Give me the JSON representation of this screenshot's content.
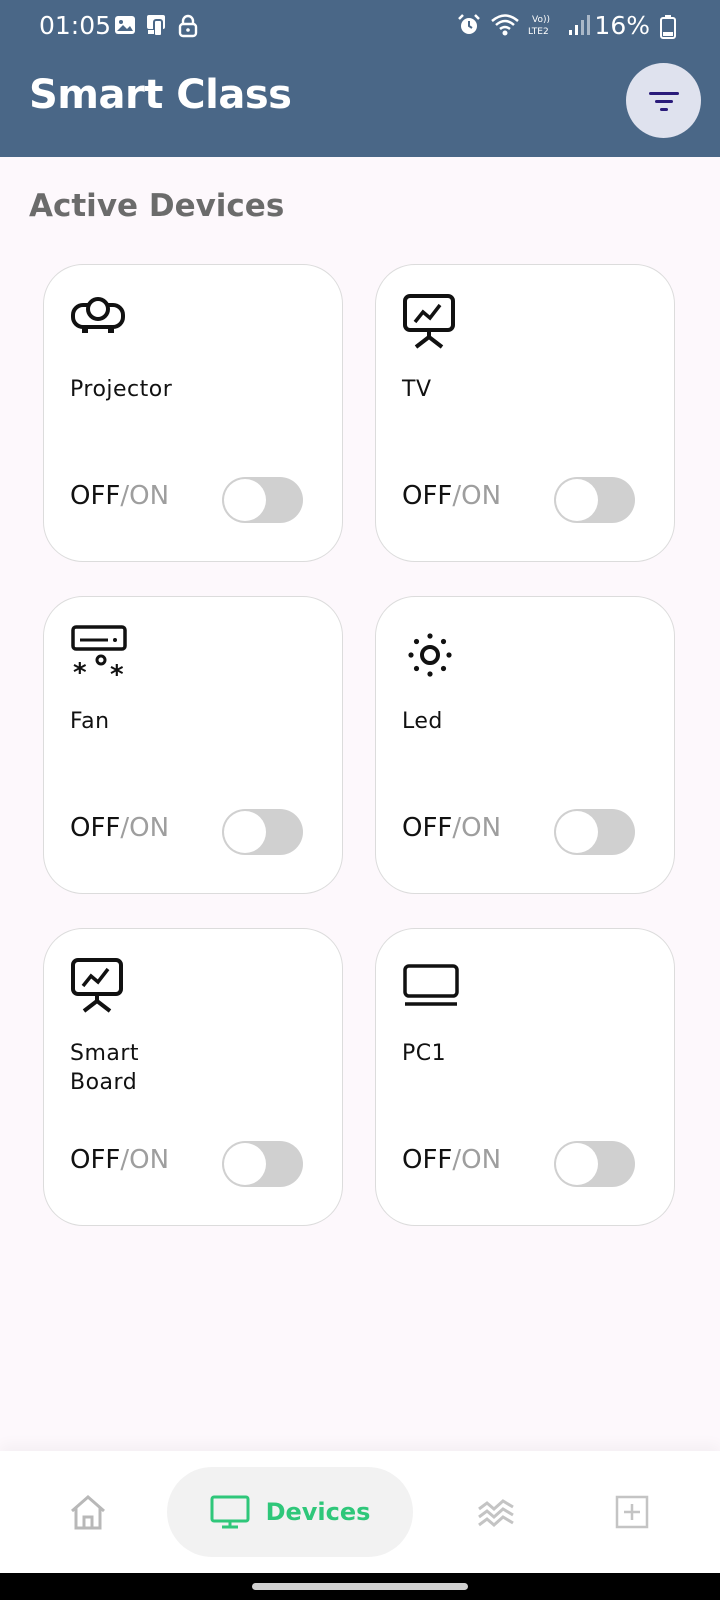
{
  "status_bar": {
    "time": "01:05",
    "battery": "16%"
  },
  "header": {
    "title": "Smart Class"
  },
  "section": {
    "title": "Active Devices"
  },
  "devices": [
    {
      "name": "Projector",
      "icon": "projector-icon",
      "off_label": "OFF",
      "separator": "/",
      "on_label": "ON",
      "is_on": false
    },
    {
      "name": "TV",
      "icon": "presentation-icon",
      "off_label": "OFF",
      "separator": "/",
      "on_label": "ON",
      "is_on": false
    },
    {
      "name": "Fan",
      "icon": "air-conditioner-icon",
      "off_label": "OFF",
      "separator": "/",
      "on_label": "ON",
      "is_on": false
    },
    {
      "name": "Led",
      "icon": "sun-icon",
      "off_label": "OFF",
      "separator": "/",
      "on_label": "ON",
      "is_on": false
    },
    {
      "name": "Smart Board",
      "icon": "presentation-icon",
      "off_label": "OFF",
      "separator": "/",
      "on_label": "ON",
      "is_on": false
    },
    {
      "name": "PC1",
      "icon": "monitor-icon",
      "off_label": "OFF",
      "separator": "/",
      "on_label": "ON",
      "is_on": false
    }
  ],
  "bottom_nav": {
    "devices_label": "Devices",
    "active_color": "#2fc77a"
  }
}
